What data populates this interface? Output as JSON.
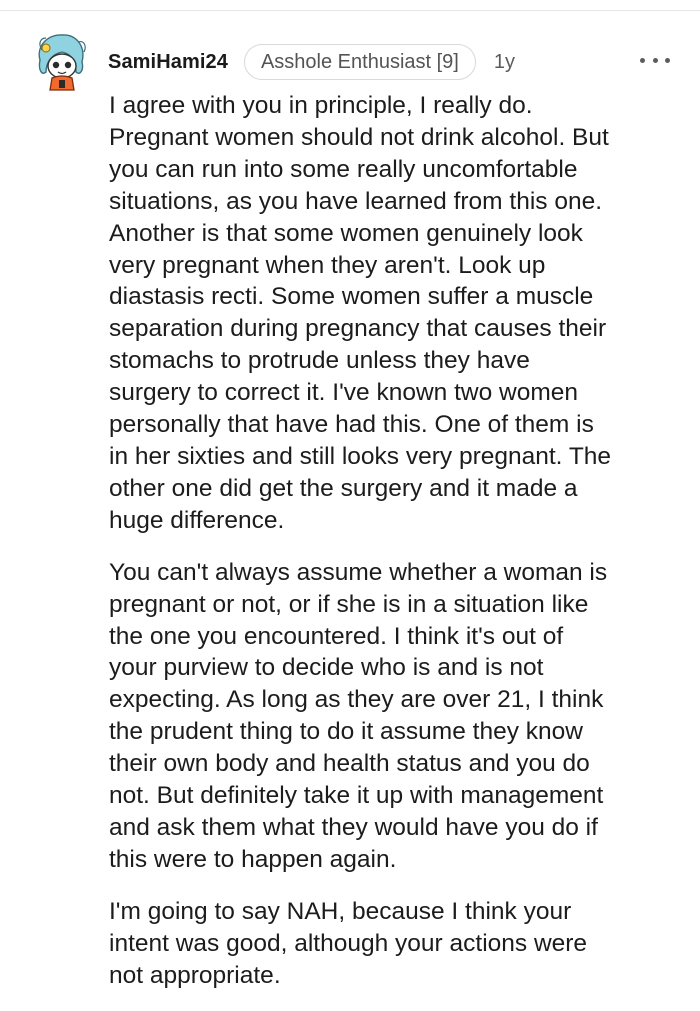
{
  "comment": {
    "username": "SamiHami24",
    "flair": "Asshole Enthusiast [9]",
    "age": "1y",
    "more_icon": "more-options-icon",
    "avatar_icon": "snoo-avatar-icon",
    "paragraphs": [
      "I agree with you in principle, I really do.\nPregnant women should not drink alcohol. But\nyou can run into some really uncomfortable\nsituations, as you have learned from this one.\nAnother is that some women genuinely look\nvery pregnant when they aren't. Look up\ndiastasis recti. Some women suffer a muscle\nseparation during pregnancy that causes their\nstomachs to protrude unless they have\nsurgery to correct it. I've known two women\npersonally that have had this. One of them is\nin her sixties and still looks very pregnant. The\nother one did get the surgery and it made a\nhuge difference.",
      "You can't always assume whether a woman is\npregnant or not, or if she is in a situation like\nthe one you encountered. I think it's out of\nyour purview to decide who is and is not\nexpecting. As long as they are over 21, I think\nthe prudent thing to do it assume they know\ntheir own body and health status and you do\nnot. But definitely take it up with management\nand ask them what they would have you do if\nthis were to happen again.",
      "I'm going to say NAH, because I think your\nintent was good, although your actions were\nnot appropriate."
    ]
  },
  "colors": {
    "text": "#1c1c1c",
    "muted": "#5c5c5c",
    "flair_border": "#d9d9d9",
    "avatar_hair": "#8fd3e0",
    "avatar_accent": "#f26a2e"
  }
}
